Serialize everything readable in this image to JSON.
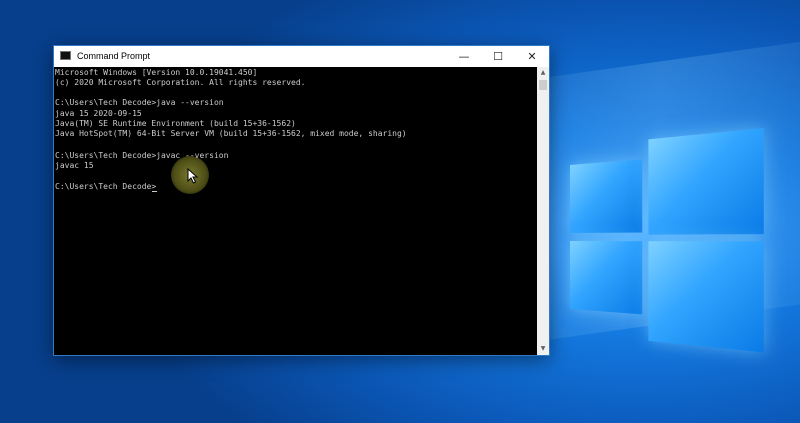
{
  "window": {
    "title": "Command Prompt",
    "controls": {
      "minimize": "—",
      "maximize": "☐",
      "close": "✕"
    }
  },
  "console": {
    "lines": [
      "Microsoft Windows [Version 10.0.19041.450]",
      "(c) 2020 Microsoft Corporation. All rights reserved.",
      "",
      "C:\\Users\\Tech Decode>java --version",
      "java 15 2020-09-15",
      "Java(TM) SE Runtime Environment (build 15+36-1562)",
      "Java HotSpot(TM) 64-Bit Server VM (build 15+36-1562, mixed mode, sharing)",
      "",
      "C:\\Users\\Tech Decode>javac --version",
      "javac 15",
      "",
      "C:\\Users\\Tech Decode>"
    ]
  },
  "scrollbar": {
    "up": "▲",
    "down": "▼"
  },
  "icons": {
    "app": "cmd-icon",
    "logo": "windows-logo",
    "pointer": "mouse-pointer-icon"
  },
  "colors": {
    "desktop": "#1479e0",
    "console_bg": "#000000",
    "console_text": "#cccccc",
    "highlight": "#a0a03c"
  }
}
